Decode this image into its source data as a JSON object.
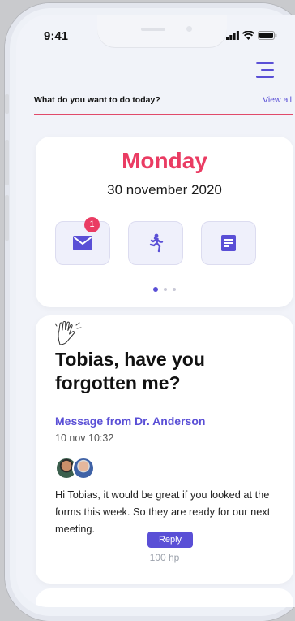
{
  "status_bar": {
    "time": "9:41"
  },
  "icons": {
    "menu": "hamburger-menu-icon",
    "mail": "mail-icon",
    "activity": "running-person-icon",
    "forms": "document-icon",
    "wave": "waving-hand-icon"
  },
  "colors": {
    "accent": "#5a4fd6",
    "highlight": "#ea3c63",
    "background": "#f1f3f9"
  },
  "section": {
    "title": "What do you want to do today?",
    "view_all": "View all"
  },
  "day_card": {
    "day": "Monday",
    "date": "30 november 2020",
    "mail_badge": "1",
    "pager_count": 3,
    "pager_active": 0
  },
  "message": {
    "title": "Tobias, have you forgotten me?",
    "from": "Message from Dr. Anderson",
    "time": "10 nov 10:32",
    "body": "Hi Tobias, it would be great if you looked at the forms this week. So they are ready for our next meeting.",
    "reply_label": "Reply",
    "reply_meta": "100 hp"
  }
}
